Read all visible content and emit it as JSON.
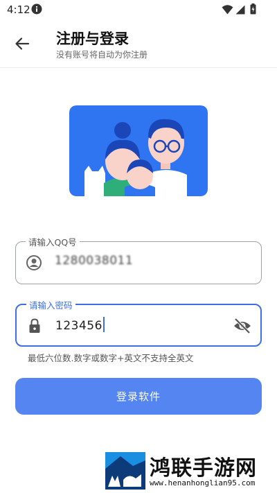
{
  "status_bar": {
    "time": "4:12",
    "icons": [
      "info-icon",
      "wifi-icon",
      "signal-icon",
      "battery-icon"
    ]
  },
  "app_bar": {
    "title": "注册与登录",
    "subtitle": "没有账号将自动为你注册",
    "back_icon": "arrow-left-icon"
  },
  "form": {
    "qq_field": {
      "label": "请输入QQ号",
      "value": "1280038011",
      "icon": "account-circle-icon"
    },
    "password_field": {
      "label": "请输入密码",
      "value": "123456",
      "icon": "lock-icon",
      "toggle_icon": "eye-off-icon"
    },
    "hint": "最低六位数.数字或数字+英文不支持全英文",
    "submit_label": "登录软件"
  },
  "watermark": {
    "name": "鸿联手游网",
    "url": "www.henanhonglian95.com"
  },
  "colors": {
    "accent": "#3b6fe3",
    "button": "#5585f0",
    "hero_bg": "#2f74f0"
  }
}
